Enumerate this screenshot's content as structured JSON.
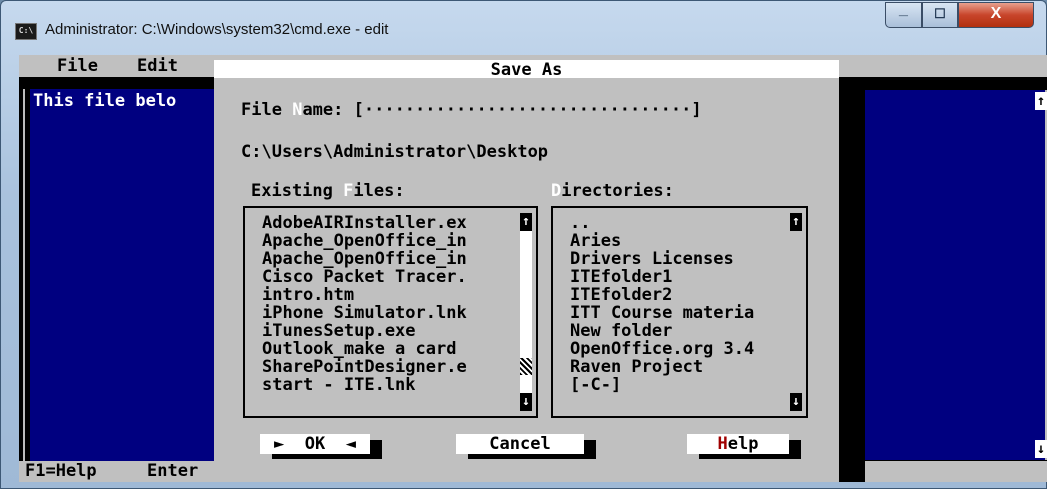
{
  "window": {
    "title": "Administrator: C:\\Windows\\system32\\cmd.exe - edit",
    "icon_label": "C:\\",
    "min_glyph": "_",
    "max_glyph": "☐",
    "close_glyph": "X"
  },
  "menu": {
    "file": "File",
    "edit": "Edit"
  },
  "editor": {
    "visible_text": "This file belo"
  },
  "status": {
    "help": "F1=Help",
    "enter": "Enter"
  },
  "dialog": {
    "title": "Save As",
    "filename_label_pre": "File ",
    "filename_label_hot": "N",
    "filename_label_post": "ame: ",
    "filename_field": "[································]",
    "path": "C:\\Users\\Administrator\\Desktop",
    "files_label_pre": "Existing ",
    "files_label_hot": "F",
    "files_label_post": "iles:",
    "dirs_label_hot": "D",
    "dirs_label_post": "irectories:",
    "files": [
      "AdobeAIRInstaller.ex",
      "Apache_OpenOffice_in",
      "Apache_OpenOffice_in",
      "Cisco Packet Tracer.",
      "intro.htm",
      "iPhone Simulator.lnk",
      "iTunesSetup.exe",
      "Outlook_make a card",
      "SharePointDesigner.e",
      "start - ITE.lnk"
    ],
    "directories": [
      "..",
      "Aries",
      "Drivers Licenses",
      "ITEfolder1",
      "ITEfolder2",
      "ITT Course materia",
      "New folder",
      "OpenOffice.org 3.4",
      "Raven Project",
      "[-C-]"
    ],
    "scroll_up": "↑",
    "scroll_down": "↓",
    "buttons": {
      "ok": "►  OK  ◄",
      "cancel": "Cancel",
      "help_hot": "H",
      "help_rest": "elp"
    }
  }
}
